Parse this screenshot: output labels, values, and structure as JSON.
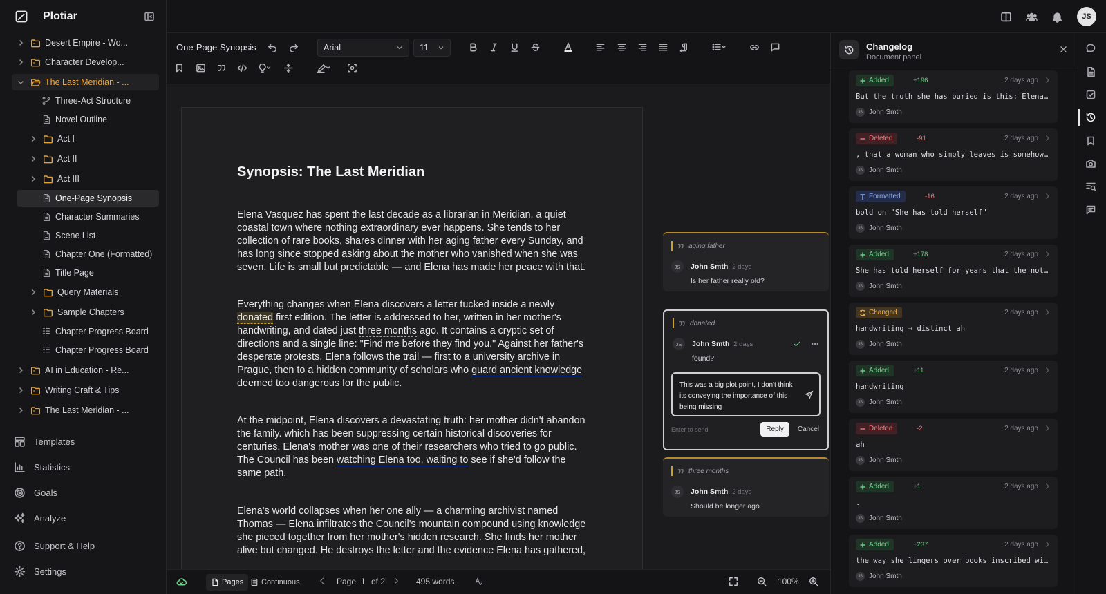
{
  "app": {
    "name": "Plotiar"
  },
  "user": {
    "initials": "JS"
  },
  "sidebar": {
    "tree": [
      {
        "label": "Desert Empire - Wo...",
        "type": "folder",
        "level": 0,
        "state": "collapsed"
      },
      {
        "label": "Character Develop...",
        "type": "folder",
        "level": 0,
        "state": "collapsed"
      },
      {
        "label": "The Last Meridian - ...",
        "type": "folder",
        "level": 0,
        "state": "expanded"
      },
      {
        "label": "Three-Act Structure",
        "type": "structure",
        "level": 1
      },
      {
        "label": "Novel Outline",
        "type": "doc",
        "level": 1
      },
      {
        "label": "Act I",
        "type": "folder",
        "level": 1,
        "state": "collapsed"
      },
      {
        "label": "Act II",
        "type": "folder",
        "level": 1,
        "state": "collapsed"
      },
      {
        "label": "Act III",
        "type": "folder",
        "level": 1,
        "state": "collapsed"
      },
      {
        "label": "One-Page Synopsis",
        "type": "doc",
        "level": 1,
        "state": "active"
      },
      {
        "label": "Character Summaries",
        "type": "doc",
        "level": 1
      },
      {
        "label": "Scene List",
        "type": "doc",
        "level": 1
      },
      {
        "label": "Chapter One (Formatted)",
        "type": "doc",
        "level": 1
      },
      {
        "label": "Title Page",
        "type": "doc",
        "level": 1
      },
      {
        "label": "Query Materials",
        "type": "folder",
        "level": 1,
        "state": "collapsed"
      },
      {
        "label": "Sample Chapters",
        "type": "folder",
        "level": 1,
        "state": "collapsed"
      },
      {
        "label": "Chapter Progress Board",
        "type": "board",
        "level": 1
      },
      {
        "label": "Chapter Progress Board",
        "type": "board",
        "level": 1
      },
      {
        "label": "AI in Education - Re...",
        "type": "folder",
        "level": 0,
        "state": "collapsed"
      },
      {
        "label": "Writing Craft & Tips",
        "type": "folder",
        "level": 0,
        "state": "collapsed"
      },
      {
        "label": "The Last Meridian - ...",
        "type": "folder",
        "level": 0,
        "state": "collapsed"
      }
    ],
    "nav": [
      {
        "label": "Templates",
        "icon": "templates-icon"
      },
      {
        "label": "Statistics",
        "icon": "chart-icon"
      },
      {
        "label": "Goals",
        "icon": "target-icon"
      },
      {
        "label": "Analyze",
        "icon": "sparkles-icon"
      },
      {
        "label": "Support & Help",
        "icon": "help-icon"
      },
      {
        "label": "Settings",
        "icon": "gear-icon"
      }
    ]
  },
  "toolbar": {
    "doc_title": "One-Page Synopsis",
    "font_family": "Arial",
    "font_size": "11",
    "text_color": "#e5e5e5"
  },
  "document": {
    "title": "Synopsis: The Last Meridian",
    "p1": {
      "a": "Elena Vasquez has spent the last decade as a librarian in Meridian, a quiet coastal town where nothing extraordinary ever happens. She tends to her collection of rare books, shares dinner with her ",
      "h": "aging father",
      "b": " every Sunday, and has long since stopped asking about the mother who vanished when she was seven. Life is small but predictable — and Elena has made her peace with that."
    },
    "p2": {
      "a": "Everything changes when Elena discovers a letter tucked inside a newly ",
      "h1": "donated",
      "b": " first edition. The letter is addressed to her, written in her mother's handwriting, and dated just ",
      "h2": "three months",
      "c": " ago. It contains a cryptic set of directions and a single line: \"Find me before they find you.\" Against her father's desperate protests, Elena follows the trail — first to a ",
      "h3": "university archive in",
      "d": " Prague, then to a hidden community of scholars who ",
      "h4": "guard ancient knowledge",
      "e": " deemed too dangerous for the public."
    },
    "p3": {
      "a": "At the midpoint, Elena discovers a devastating truth: her mother didn't abandon the family. which has been suppressing certain historical discoveries for centuries. Elena's mother was one of their researchers who tried to go public. The Council has been ",
      "h": "watching Elena too, waiting to",
      "b": " see if she'd follow the same path."
    },
    "p4": "Elena's world collapses when her one ally — a charming archivist named Thomas — Elena infiltrates the Council's mountain compound using knowledge she pieced together from her mother's hidden research. She finds her mother alive but changed. He destroys the letter and the evidence Elena has gathered,"
  },
  "comments": [
    {
      "quote": "aging father",
      "author": "John Smth",
      "time": "2 days",
      "initials": "JS",
      "body": "Is her father really old?"
    },
    {
      "quote": "donated",
      "author": "John Smth",
      "time": "2 days",
      "initials": "JS",
      "body": "found?",
      "reply_text": "This was a big plot point, I don't think its conveying the importance of this being missing",
      "reply_hint": "Enter to send",
      "reply_label": "Reply",
      "cancel_label": "Cancel"
    },
    {
      "quote": "three months",
      "author": "John Smth",
      "time": "2 days",
      "initials": "JS",
      "body": "Should be longer ago"
    }
  ],
  "statusbar": {
    "pages_label": "Pages",
    "continuous_label": "Continuous",
    "page_label": "Page",
    "page_current": "1",
    "page_of": "of 2",
    "word_count": "495 words",
    "zoom": "100%"
  },
  "changelog": {
    "title": "Changelog",
    "subtitle": "Document panel",
    "entries": [
      {
        "type": "Added",
        "delta": "+196",
        "time": "2 days ago",
        "text": "But the truth she has buried is this: Elena...",
        "user": "John Smth"
      },
      {
        "type": "Deleted",
        "delta": "-91",
        "time": "2 days ago",
        "text": ", that a woman who simply leaves is somehow...",
        "user": "John Smth"
      },
      {
        "type": "Formatted",
        "delta": "-16",
        "time": "2 days ago",
        "text": "bold on \"She has told herself\"",
        "user": "John Smth"
      },
      {
        "type": "Added",
        "delta": "+178",
        "time": "2 days ago",
        "text": "She has told herself for years that the not...",
        "user": "John Smth"
      },
      {
        "type": "Changed",
        "delta": "",
        "time": "2 days ago",
        "text": "handwriting → distinct ah",
        "user": "John Smth"
      },
      {
        "type": "Added",
        "delta": "+11",
        "time": "2 days ago",
        "text": "handwriting",
        "user": "John Smth"
      },
      {
        "type": "Deleted",
        "delta": "-2",
        "time": "2 days ago",
        "text": "ah",
        "user": "John Smth"
      },
      {
        "type": "Added",
        "delta": "+1",
        "time": "2 days ago",
        "text": ".",
        "user": "John Smth"
      },
      {
        "type": "Added",
        "delta": "+237",
        "time": "2 days ago",
        "text": "the way she lingers over books inscribed wi...",
        "user": "John Smth"
      }
    ]
  }
}
